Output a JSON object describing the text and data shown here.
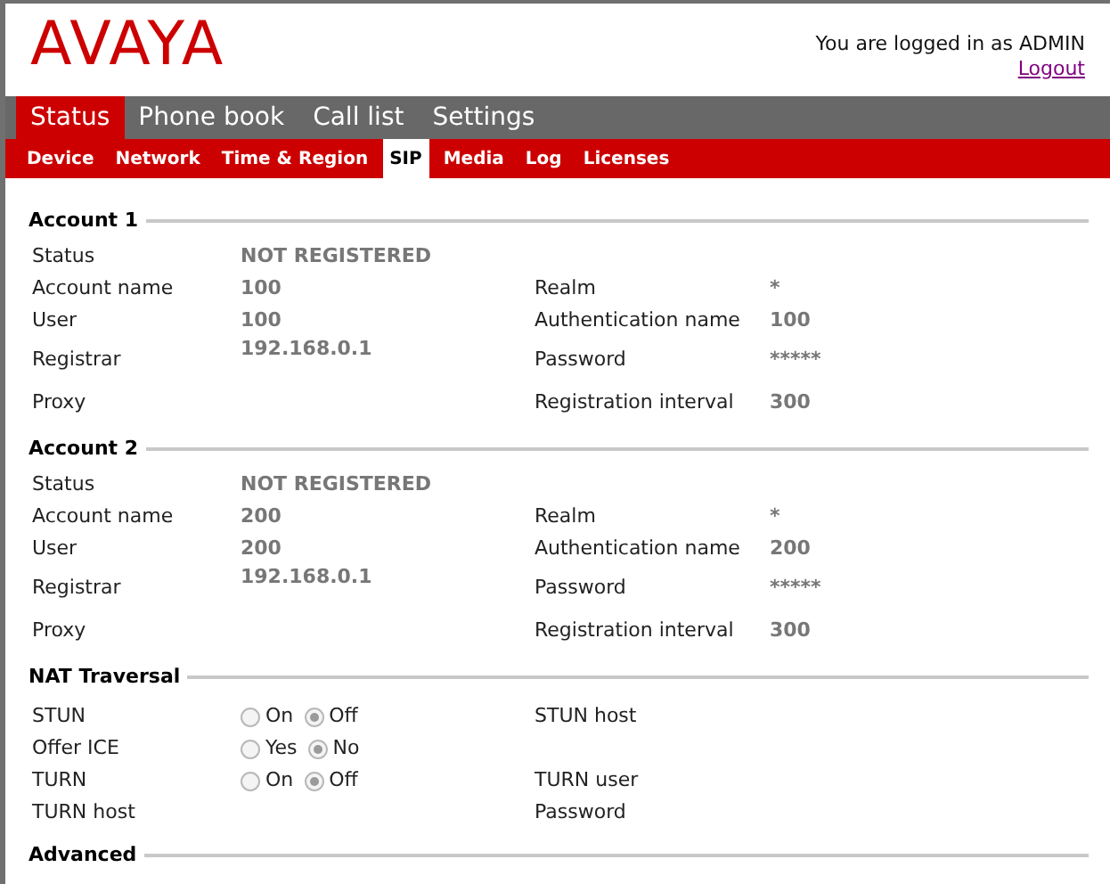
{
  "header": {
    "logo": "AVAYA",
    "login_text": "You are logged in as ADMIN",
    "logout": "Logout"
  },
  "main_tabs": [
    {
      "label": "Status",
      "selected": true
    },
    {
      "label": "Phone book",
      "selected": false
    },
    {
      "label": "Call list",
      "selected": false
    },
    {
      "label": "Settings",
      "selected": false
    }
  ],
  "sub_tabs": [
    {
      "label": "Device",
      "selected": false
    },
    {
      "label": "Network",
      "selected": false
    },
    {
      "label": "Time & Region",
      "selected": false
    },
    {
      "label": "SIP",
      "selected": true
    },
    {
      "label": "Media",
      "selected": false
    },
    {
      "label": "Log",
      "selected": false
    },
    {
      "label": "Licenses",
      "selected": false
    }
  ],
  "sections": [
    {
      "title": "Account 1",
      "kind": "account",
      "rows": [
        {
          "label": "Status",
          "value": "NOT REGISTERED"
        },
        {
          "label": "Account name",
          "value": "100",
          "right_label": "Realm",
          "right_value": "*"
        },
        {
          "label": "User",
          "value": "100",
          "right_label": "Authentication name",
          "right_value": "100"
        },
        {
          "label": "Registrar",
          "value": "192.168.0.1",
          "right_label": "Password",
          "right_value": "*****"
        },
        {
          "label": "Proxy",
          "right_label": "Registration interval",
          "right_value": "300"
        }
      ]
    },
    {
      "title": "Account 2",
      "kind": "account",
      "rows": [
        {
          "label": "Status",
          "value": "NOT REGISTERED"
        },
        {
          "label": "Account name",
          "value": "200",
          "right_label": "Realm",
          "right_value": "*"
        },
        {
          "label": "User",
          "value": "200",
          "right_label": "Authentication name",
          "right_value": "200"
        },
        {
          "label": "Registrar",
          "value": "192.168.0.1",
          "right_label": "Password",
          "right_value": "*****"
        },
        {
          "label": "Proxy",
          "right_label": "Registration interval",
          "right_value": "300"
        }
      ]
    },
    {
      "title": "NAT Traversal",
      "kind": "nat",
      "rows": [
        {
          "label": "STUN",
          "options": [
            {
              "label": "On",
              "selected": false
            },
            {
              "label": "Off",
              "selected": true
            }
          ],
          "right_label": "STUN host"
        },
        {
          "label": "Offer ICE",
          "options": [
            {
              "label": "Yes",
              "selected": false
            },
            {
              "label": "No",
              "selected": true
            }
          ]
        },
        {
          "label": "TURN",
          "options": [
            {
              "label": "On",
              "selected": false
            },
            {
              "label": "Off",
              "selected": true
            }
          ],
          "right_label": "TURN user"
        },
        {
          "label": "TURN host",
          "right_label": "Password"
        }
      ]
    },
    {
      "title": "Advanced",
      "kind": "heading_only"
    }
  ]
}
